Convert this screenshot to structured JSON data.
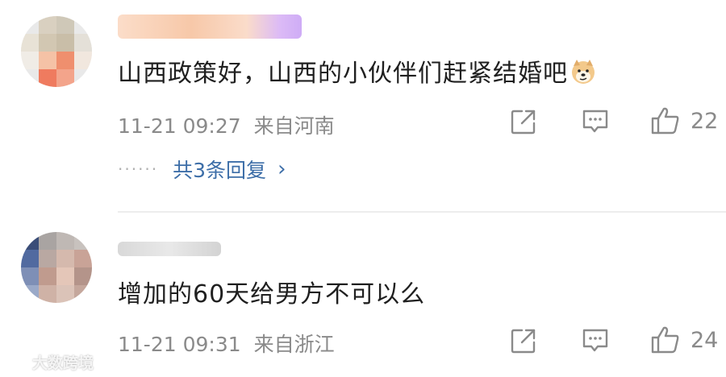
{
  "comments": [
    {
      "text": "山西政策好，山西的小伙伴们赶紧结婚吧",
      "emoji": "doge-emoji",
      "date": "11-21 09:27",
      "location": "来自河南",
      "likes": "22",
      "replies_label": "共3条回复",
      "replies_dots": "······"
    },
    {
      "text": "增加的60天给男方不可以么",
      "date": "11-21 09:31",
      "location": "来自浙江",
      "likes": "24"
    }
  ],
  "icons": {
    "share": "share-icon",
    "comment": "comment-icon",
    "like": "thumbs-up-icon"
  },
  "colors": {
    "text": "#1f1f1f",
    "meta": "#8a8a8a",
    "link": "#3d6ea8",
    "username_blur_a": "#f8c9a6",
    "username_blur_b": "#c9a3f5"
  },
  "watermark": {
    "text": "大数跨境"
  }
}
